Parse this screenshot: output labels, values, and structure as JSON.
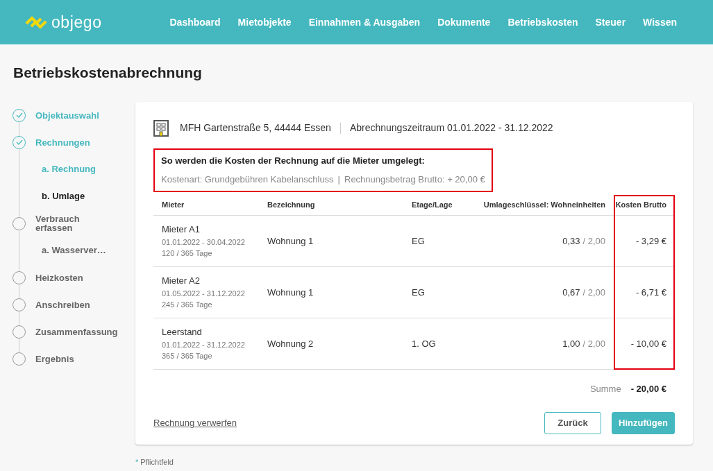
{
  "brand": "objego",
  "nav": [
    "Dashboard",
    "Mietobjekte",
    "Einnahmen & Ausgaben",
    "Dokumente",
    "Betriebskosten",
    "Steuer",
    "Wissen"
  ],
  "page_title": "Betriebskostenabrechnung",
  "steps": [
    {
      "label": "Objektauswahl",
      "completed": true
    },
    {
      "label": "Rechnungen",
      "completed": true,
      "substeps": [
        {
          "label": "a. Rechnung",
          "completed": true,
          "current": false
        },
        {
          "label": "b. Umlage",
          "completed": false,
          "current": true
        }
      ]
    },
    {
      "label": "Verbrauch erfassen",
      "completed": false,
      "substeps": [
        {
          "label": "a. Wasserver…",
          "completed": false,
          "current": false
        }
      ]
    },
    {
      "label": "Heizkosten",
      "completed": false
    },
    {
      "label": "Anschreiben",
      "completed": false
    },
    {
      "label": "Zusammenfassung",
      "completed": false
    },
    {
      "label": "Ergebnis",
      "completed": false
    }
  ],
  "property": "MFH Gartenstraße 5, 44444 Essen",
  "period": "Abrechnungszeitraum 01.01.2022 - 31.12.2022",
  "summary": {
    "highlighted": true,
    "heading": "So werden die Kosten der Rechnung auf die Mieter umgelegt:",
    "cost_type": "Kostenart: Grundgebühren Kabelanschluss",
    "separator": "|",
    "amount": "Rechnungsbetrag Brutto: + 20,00 €"
  },
  "table": {
    "columns": [
      {
        "label": "Mieter",
        "highlighted": false
      },
      {
        "label": "Bezeichnung",
        "highlighted": false
      },
      {
        "label": "Etage/Lage",
        "highlighted": false
      },
      {
        "label": "Umlageschlüssel: Wohneinheiten",
        "highlighted": false
      },
      {
        "label": "Kosten Brutto",
        "highlighted": true
      }
    ],
    "rows": [
      {
        "tenant": "Mieter A1",
        "dates": "01.01.2022 - 30.04.2022",
        "days": "120 / 365 Tage",
        "unit": "Wohnung 1",
        "floor": "EG",
        "share": "0,33",
        "share_total": "/ 2,00",
        "cost": "- 3,29 €"
      },
      {
        "tenant": "Mieter A2",
        "dates": "01.05.2022 - 31.12.2022",
        "days": "245 / 365 Tage",
        "unit": "Wohnung 1",
        "floor": "EG",
        "share": "0,67",
        "share_total": "/ 2,00",
        "cost": "- 6,71 €"
      },
      {
        "tenant": "Leerstand",
        "dates": "01.01.2022 - 31.12.2022",
        "days": "365 / 365 Tage",
        "unit": "Wohnung 2",
        "floor": "1. OG",
        "share": "1,00",
        "share_total": "/ 2,00",
        "cost": "- 10,00 €"
      }
    ]
  },
  "sum_label": "Summe",
  "sum_value": "- 20,00 €",
  "discard_link": "Rechnung verwerfen",
  "buttons": [
    {
      "label": "Zurück",
      "kind": "secondary"
    },
    {
      "label": "Hinzufügen",
      "kind": "primary"
    }
  ],
  "required_mark": "*",
  "required_note": "Pflichtfeld"
}
